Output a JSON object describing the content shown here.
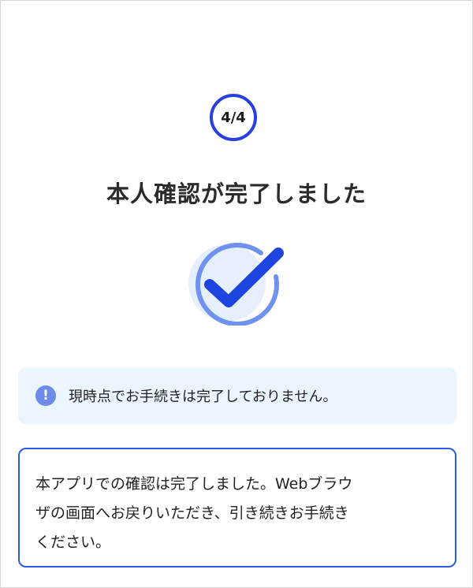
{
  "step": {
    "label": "4/4"
  },
  "title": "本人確認が完了しました",
  "notice": {
    "icon": "info-exclamation-icon",
    "text": "現時点でお手続きは完了しておりません。"
  },
  "message": {
    "lines": [
      "本アプリでの確認は完了しました。Webブラウ",
      "ザの画面へお戻りいただき、引き続きお手続き",
      "ください。"
    ]
  },
  "colors": {
    "accent": "#2a3fe0",
    "check_stroke": "#1e44e0",
    "check_ring": "#6f92ef",
    "check_fill": "#e6f0fd",
    "notice_bg": "#eaf5fc",
    "notice_icon": "#6d8ce8",
    "message_border": "#2a5be6"
  }
}
